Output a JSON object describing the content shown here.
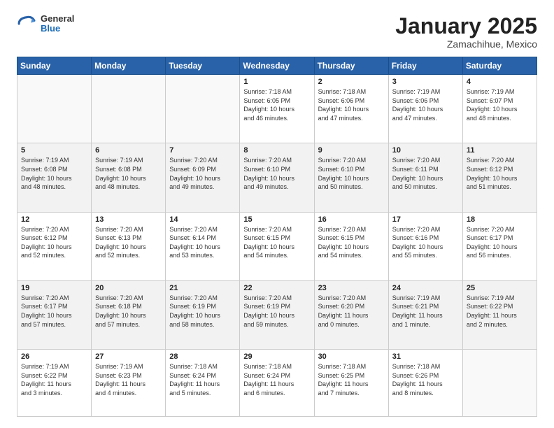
{
  "header": {
    "logo": {
      "general": "General",
      "blue": "Blue"
    },
    "title": "January 2025",
    "location": "Zamachihue, Mexico"
  },
  "calendar": {
    "days_of_week": [
      "Sunday",
      "Monday",
      "Tuesday",
      "Wednesday",
      "Thursday",
      "Friday",
      "Saturday"
    ],
    "weeks": [
      [
        {
          "day": "",
          "info": ""
        },
        {
          "day": "",
          "info": ""
        },
        {
          "day": "",
          "info": ""
        },
        {
          "day": "1",
          "info": "Sunrise: 7:18 AM\nSunset: 6:05 PM\nDaylight: 10 hours\nand 46 minutes."
        },
        {
          "day": "2",
          "info": "Sunrise: 7:18 AM\nSunset: 6:06 PM\nDaylight: 10 hours\nand 47 minutes."
        },
        {
          "day": "3",
          "info": "Sunrise: 7:19 AM\nSunset: 6:06 PM\nDaylight: 10 hours\nand 47 minutes."
        },
        {
          "day": "4",
          "info": "Sunrise: 7:19 AM\nSunset: 6:07 PM\nDaylight: 10 hours\nand 48 minutes."
        }
      ],
      [
        {
          "day": "5",
          "info": "Sunrise: 7:19 AM\nSunset: 6:08 PM\nDaylight: 10 hours\nand 48 minutes."
        },
        {
          "day": "6",
          "info": "Sunrise: 7:19 AM\nSunset: 6:08 PM\nDaylight: 10 hours\nand 48 minutes."
        },
        {
          "day": "7",
          "info": "Sunrise: 7:20 AM\nSunset: 6:09 PM\nDaylight: 10 hours\nand 49 minutes."
        },
        {
          "day": "8",
          "info": "Sunrise: 7:20 AM\nSunset: 6:10 PM\nDaylight: 10 hours\nand 49 minutes."
        },
        {
          "day": "9",
          "info": "Sunrise: 7:20 AM\nSunset: 6:10 PM\nDaylight: 10 hours\nand 50 minutes."
        },
        {
          "day": "10",
          "info": "Sunrise: 7:20 AM\nSunset: 6:11 PM\nDaylight: 10 hours\nand 50 minutes."
        },
        {
          "day": "11",
          "info": "Sunrise: 7:20 AM\nSunset: 6:12 PM\nDaylight: 10 hours\nand 51 minutes."
        }
      ],
      [
        {
          "day": "12",
          "info": "Sunrise: 7:20 AM\nSunset: 6:12 PM\nDaylight: 10 hours\nand 52 minutes."
        },
        {
          "day": "13",
          "info": "Sunrise: 7:20 AM\nSunset: 6:13 PM\nDaylight: 10 hours\nand 52 minutes."
        },
        {
          "day": "14",
          "info": "Sunrise: 7:20 AM\nSunset: 6:14 PM\nDaylight: 10 hours\nand 53 minutes."
        },
        {
          "day": "15",
          "info": "Sunrise: 7:20 AM\nSunset: 6:15 PM\nDaylight: 10 hours\nand 54 minutes."
        },
        {
          "day": "16",
          "info": "Sunrise: 7:20 AM\nSunset: 6:15 PM\nDaylight: 10 hours\nand 54 minutes."
        },
        {
          "day": "17",
          "info": "Sunrise: 7:20 AM\nSunset: 6:16 PM\nDaylight: 10 hours\nand 55 minutes."
        },
        {
          "day": "18",
          "info": "Sunrise: 7:20 AM\nSunset: 6:17 PM\nDaylight: 10 hours\nand 56 minutes."
        }
      ],
      [
        {
          "day": "19",
          "info": "Sunrise: 7:20 AM\nSunset: 6:17 PM\nDaylight: 10 hours\nand 57 minutes."
        },
        {
          "day": "20",
          "info": "Sunrise: 7:20 AM\nSunset: 6:18 PM\nDaylight: 10 hours\nand 57 minutes."
        },
        {
          "day": "21",
          "info": "Sunrise: 7:20 AM\nSunset: 6:19 PM\nDaylight: 10 hours\nand 58 minutes."
        },
        {
          "day": "22",
          "info": "Sunrise: 7:20 AM\nSunset: 6:19 PM\nDaylight: 10 hours\nand 59 minutes."
        },
        {
          "day": "23",
          "info": "Sunrise: 7:20 AM\nSunset: 6:20 PM\nDaylight: 11 hours\nand 0 minutes."
        },
        {
          "day": "24",
          "info": "Sunrise: 7:19 AM\nSunset: 6:21 PM\nDaylight: 11 hours\nand 1 minute."
        },
        {
          "day": "25",
          "info": "Sunrise: 7:19 AM\nSunset: 6:22 PM\nDaylight: 11 hours\nand 2 minutes."
        }
      ],
      [
        {
          "day": "26",
          "info": "Sunrise: 7:19 AM\nSunset: 6:22 PM\nDaylight: 11 hours\nand 3 minutes."
        },
        {
          "day": "27",
          "info": "Sunrise: 7:19 AM\nSunset: 6:23 PM\nDaylight: 11 hours\nand 4 minutes."
        },
        {
          "day": "28",
          "info": "Sunrise: 7:18 AM\nSunset: 6:24 PM\nDaylight: 11 hours\nand 5 minutes."
        },
        {
          "day": "29",
          "info": "Sunrise: 7:18 AM\nSunset: 6:24 PM\nDaylight: 11 hours\nand 6 minutes."
        },
        {
          "day": "30",
          "info": "Sunrise: 7:18 AM\nSunset: 6:25 PM\nDaylight: 11 hours\nand 7 minutes."
        },
        {
          "day": "31",
          "info": "Sunrise: 7:18 AM\nSunset: 6:26 PM\nDaylight: 11 hours\nand 8 minutes."
        },
        {
          "day": "",
          "info": ""
        }
      ]
    ]
  }
}
